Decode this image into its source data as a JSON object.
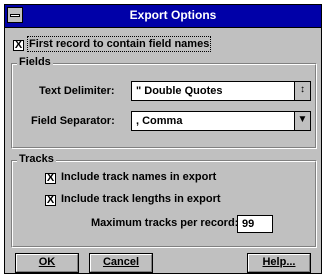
{
  "window": {
    "title": "Export Options"
  },
  "first_record": {
    "label": "First record to contain field names",
    "checked": true
  },
  "fields_group": {
    "legend": "Fields",
    "text_delimiter": {
      "label": "Text Delimiter:",
      "value": "\" Double Quotes"
    },
    "field_separator": {
      "label": "Field Separator:",
      "value": ", Comma"
    }
  },
  "tracks_group": {
    "legend": "Tracks",
    "include_names": {
      "label": "Include track names in export",
      "checked": true
    },
    "include_lengths": {
      "label": "Include track lengths in export",
      "checked": true
    },
    "max_tracks": {
      "label": "Maximum tracks per record:",
      "value": "99"
    }
  },
  "buttons": {
    "ok": "OK",
    "cancel": "Cancel",
    "help": "Help..."
  },
  "glyphs": {
    "check": "X",
    "combo_arrow_1": "↕",
    "combo_arrow_2": "▼"
  },
  "colors": {
    "title_bar": "#0000a8",
    "face": "#c0c0c0"
  }
}
